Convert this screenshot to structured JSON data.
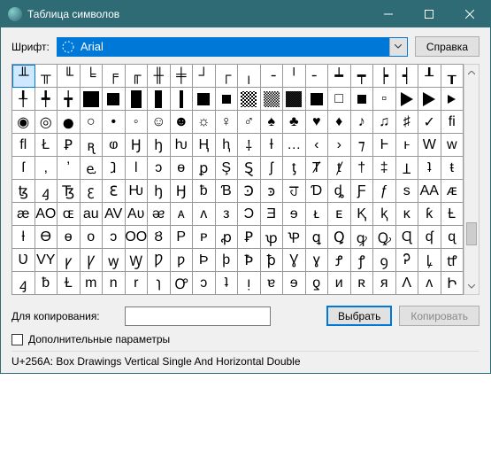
{
  "window": {
    "title": "Таблица символов"
  },
  "font": {
    "label": "Шрифт:",
    "selected": "Arial"
  },
  "buttons": {
    "help": "Справка",
    "select": "Выбрать",
    "copy": "Копировать"
  },
  "copy": {
    "label": "Для копирования:",
    "value": ""
  },
  "advanced": {
    "label": "Дополнительные параметры",
    "checked": false
  },
  "status": "U+256A: Box Drawings Vertical Single And Horizontal Double",
  "grid": {
    "selected_index": 0,
    "rows": [
      [
        "╨",
        "╥",
        "╙",
        "╘",
        "╒",
        "╓",
        "╫",
        "╪",
        "┘",
        "┌",
        "╷",
        "╶",
        "╵",
        "╴",
        "┷",
        "┯",
        "┝",
        "┥",
        "┸",
        "┰"
      ],
      [
        "╀",
        "╇",
        "╈",
        "█",
        "▄",
        "▌",
        "▐",
        "▀",
        "▮",
        "▬",
        "░",
        "▒",
        "▓",
        "■",
        "□",
        "▪",
        "▫",
        "▶",
        "►",
        "▸"
      ],
      [
        "◉",
        "◎",
        "●",
        "○",
        "•",
        "◦",
        "☺",
        "☻",
        "☼",
        "♀",
        "♂",
        "♠",
        "♣",
        "♥",
        "♦",
        "♪",
        "♫",
        "♯",
        "✓",
        "ﬁ"
      ],
      [
        "ﬂ",
        "Ł",
        "Ꝑ",
        "ꭆ",
        "ⱷ",
        "Ꜧ",
        "ꜧ",
        "ƕ",
        "Ⱨ",
        "ⱨ",
        "⸸",
        "Ɨ",
        "…",
        "‹",
        "›",
        "⁊",
        "Ⱶ",
        "ⱶ",
        "W",
        "w"
      ],
      [
        "ſ",
        "‚",
        "ʼ",
        "ⱸ",
        "ⱹ",
        "l",
        "ɔ",
        "ɵ",
        "ꝑ",
        "Ş",
        "Ȿ",
        "ʃ",
        "ƫ",
        "Ⱦ",
        "ⱦ",
        "†",
        "‡",
        "Ʇ",
        "ʇ",
        "ŧ"
      ],
      [
        "ꜩ",
        "ꜭ",
        "Ꜩ",
        "ꜫ",
        "Ꜫ",
        "Ƕ",
        "ꜧ",
        "Ꜧ",
        "ƀ",
        "Ɓ",
        "Ꜿ",
        "ꜿ",
        "ਹ",
        "Ɗ",
        "ȡ",
        "Ƒ",
        "ƒ",
        "s",
        "AA",
        "ᴁ"
      ],
      [
        "æ",
        "AO",
        "ɶ",
        "au",
        "AV",
        "Aʋ",
        "ᴂ",
        "ᴀ",
        "ʌ",
        "ᴈ",
        "Ɔ",
        "Ǝ",
        "ɘ",
        "ᴌ",
        "ᴇ",
        "Ⱪ",
        "ⱪ",
        "ᴋ",
        "ƙ",
        "Ƚ"
      ],
      [
        "ƚ",
        "Ɵ",
        "ɵ",
        "ᴏ",
        "ᴐ",
        "OO",
        "Ȣ",
        "P",
        "ᴘ",
        "ꝓ",
        "Ꝑ",
        "ꝕ",
        "Ꝕ",
        "ꝗ",
        "Ꝗ",
        "ꝙ",
        "Ꝙ",
        "Ɋ",
        "ʠ",
        "ɋ"
      ],
      [
        "Ʋ",
        "VY",
        "ꝩ",
        "Ꝩ",
        "ꝡ",
        "Ꝡ",
        "Ƿ",
        "ƿ",
        "Þ",
        "þ",
        "Ꝥ",
        "ꝥ",
        "Ɣ",
        "ɣ",
        "Ꝭ",
        "ꝭ",
        "ꝯ",
        "Ꭾ",
        "ꝲ",
        "ꝷ"
      ],
      [
        "ꜭ",
        "ƀ",
        "Ɫ",
        "m",
        "n",
        "r",
        "ɿ",
        "Ꝍ",
        "ɔ",
        "ʇ",
        "ᴉ",
        "ɐ",
        "ɘ",
        "ƍ",
        "ᴎ",
        "ʀ",
        "ᴙ",
        "Ʌ",
        "ᴧ",
        "Ի"
      ]
    ]
  }
}
